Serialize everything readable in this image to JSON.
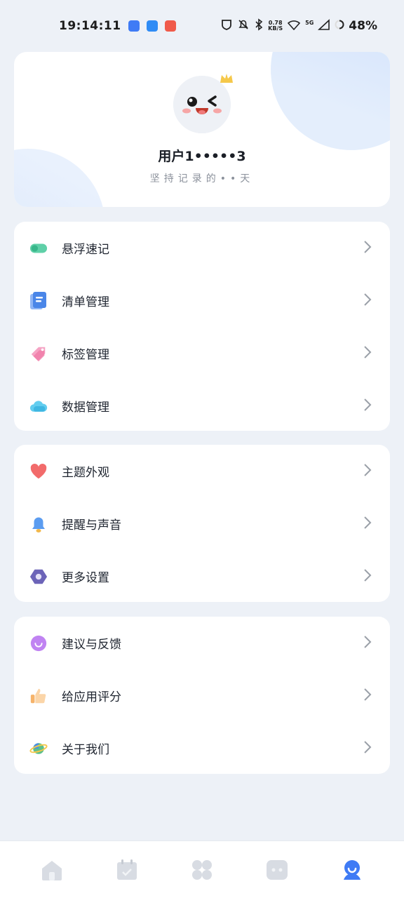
{
  "status_bar": {
    "time": "19:14:11",
    "net_speed_value": "0.78",
    "net_speed_unit": "KB/S",
    "network_type": "5G",
    "battery": "48%"
  },
  "profile": {
    "username": "用户1•••••3",
    "slogan": "坚持记录的••天"
  },
  "menu_groups": [
    {
      "items": [
        {
          "label": "悬浮速记",
          "icon": "floating-note-icon",
          "color": "#4fc3a1"
        },
        {
          "label": "清单管理",
          "icon": "list-icon",
          "color": "#4a86e8"
        },
        {
          "label": "标签管理",
          "icon": "tag-icon",
          "color": "#f28ab2"
        },
        {
          "label": "数据管理",
          "icon": "cloud-icon",
          "color": "#4fc0e8"
        }
      ]
    },
    {
      "items": [
        {
          "label": "主题外观",
          "icon": "heart-icon",
          "color": "#f06a6a"
        },
        {
          "label": "提醒与声音",
          "icon": "bell-icon",
          "color": "#5b9cf0"
        },
        {
          "label": "更多设置",
          "icon": "settings-hex-icon",
          "color": "#6b63b5"
        }
      ]
    },
    {
      "items": [
        {
          "label": "建议与反馈",
          "icon": "feedback-bubble-icon",
          "color": "#b06af0"
        },
        {
          "label": "给应用评分",
          "icon": "thumbs-up-icon",
          "color": "#f3a64e"
        },
        {
          "label": "关于我们",
          "icon": "planet-icon",
          "color": "#5cc08a"
        }
      ]
    }
  ],
  "bottom_nav": [
    {
      "name": "home",
      "icon": "home-icon",
      "active": false
    },
    {
      "name": "calendar",
      "icon": "calendar-check-icon",
      "active": false
    },
    {
      "name": "apps",
      "icon": "apps-grid-icon",
      "active": false
    },
    {
      "name": "focus",
      "icon": "focus-icon",
      "active": false
    },
    {
      "name": "profile",
      "icon": "profile-icon",
      "active": true
    }
  ],
  "colors": {
    "accent": "#3f7bf5",
    "inactive_nav": "#d5d9e0",
    "background": "#edf1f7"
  }
}
